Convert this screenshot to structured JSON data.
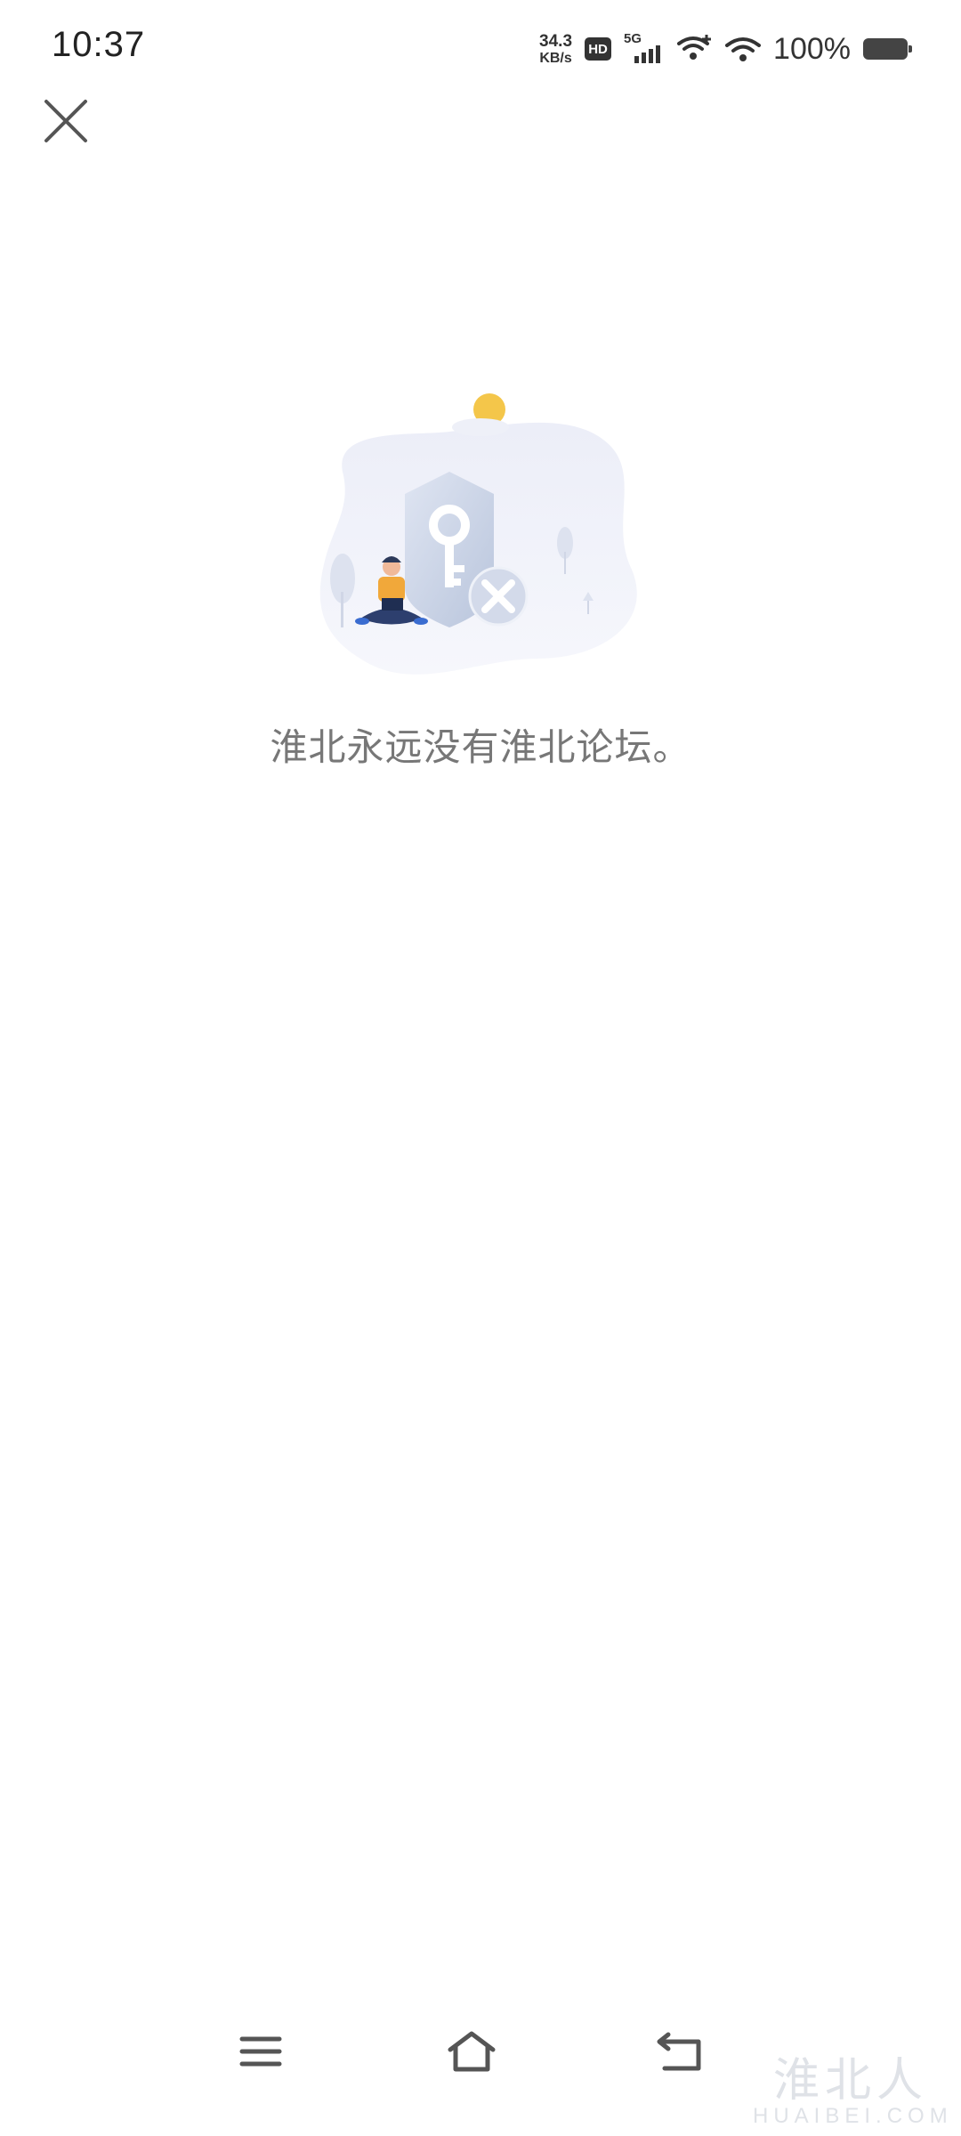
{
  "status_bar": {
    "time": "10:37",
    "net_speed_value": "34.3",
    "net_speed_unit": "KB/s",
    "hd_label": "HD",
    "network_type": "5G",
    "battery_percent": "100%"
  },
  "header": {
    "close_icon": "close-icon"
  },
  "main": {
    "illustration_icon": "shield-key-blocked-illustration",
    "message": "淮北永远没有淮北论坛。"
  },
  "nav": {
    "menu_icon": "menu-icon",
    "home_icon": "home-icon",
    "back_icon": "back-icon"
  },
  "watermark": {
    "logo_text": "淮北人",
    "domain_text": "HUAIBEI.COM"
  }
}
